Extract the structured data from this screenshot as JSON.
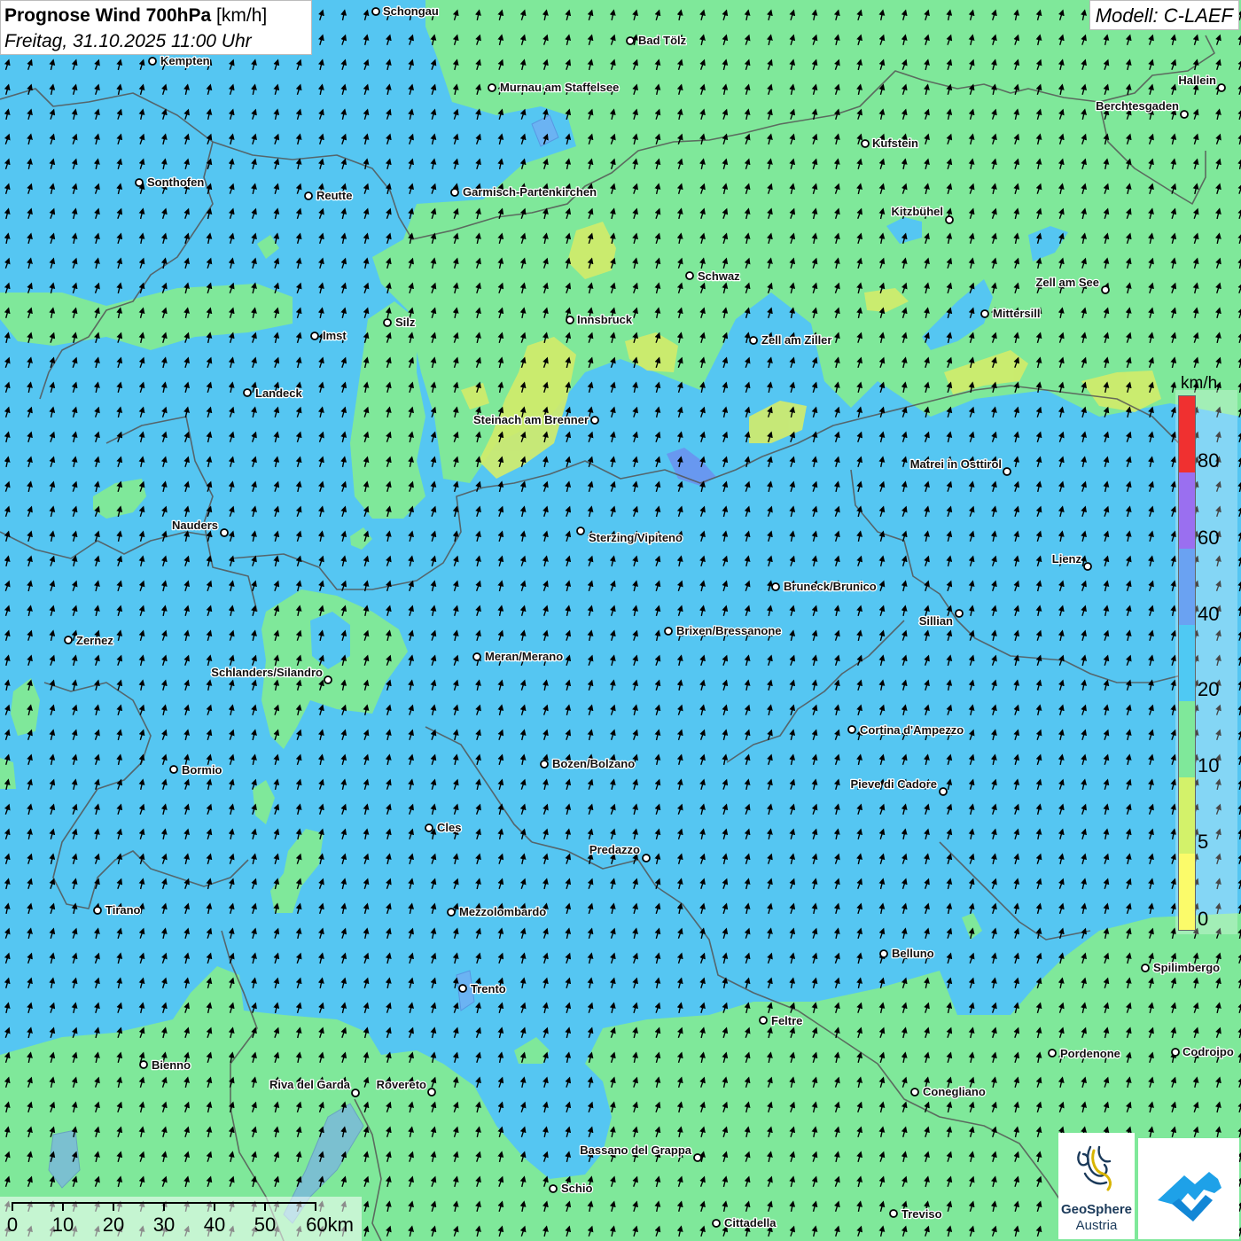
{
  "header": {
    "title_bold": "Prognose Wind 700hPa",
    "title_unit": "[km/h]",
    "subtitle": "Freitag, 31.10.2025 11:00 Uhr",
    "model": "Modell: C-LAEF"
  },
  "legend": {
    "unit": "km/h",
    "labels": [
      "80",
      "60",
      "40",
      "20",
      "10",
      "5",
      "0"
    ],
    "colors_top_to_bottom": [
      "#f03030",
      "#9a6ff0",
      "#6aa2f2",
      "#4fc9f3",
      "#7fe89a",
      "#d3f26a",
      "#fbfb6a"
    ]
  },
  "scale_bar": {
    "labels": [
      "0",
      "10",
      "20",
      "30",
      "40",
      "50",
      "60km"
    ]
  },
  "logos": {
    "geosphere_line1": "GeoSphere",
    "geosphere_line2": "Austria",
    "geosphere_icon": "geosphere-swirl-icon",
    "app_icon": "wetter-app-icon"
  },
  "map": {
    "wind_direction": "north-northeast",
    "arrow_icon": "wind-arrow-icon",
    "cities": [
      {
        "name": "Schongau"
      },
      {
        "name": "Bad Tölz"
      },
      {
        "name": "Kempten"
      },
      {
        "name": "Murnau am Staffelsee"
      },
      {
        "name": "Hallein"
      },
      {
        "name": "Berchtesgaden"
      },
      {
        "name": "Kufstein"
      },
      {
        "name": "Sonthofen"
      },
      {
        "name": "Reutte"
      },
      {
        "name": "Garmisch-Partenkirchen"
      },
      {
        "name": "Kitzbühel"
      },
      {
        "name": "Schwaz"
      },
      {
        "name": "Zell am See"
      },
      {
        "name": "Mittersill"
      },
      {
        "name": "Silz"
      },
      {
        "name": "Innsbruck"
      },
      {
        "name": "Imst"
      },
      {
        "name": "Zell am Ziller"
      },
      {
        "name": "Landeck"
      },
      {
        "name": "Steinach am Brenner"
      },
      {
        "name": "Matrei in Osttirol"
      },
      {
        "name": "Nauders"
      },
      {
        "name": "Sterzing/Vipiteno"
      },
      {
        "name": "Lienz"
      },
      {
        "name": "Bruneck/Brunico"
      },
      {
        "name": "Sillian"
      },
      {
        "name": "Zernez"
      },
      {
        "name": "Brixen/Bressanone"
      },
      {
        "name": "Meran/Merano"
      },
      {
        "name": "Schlanders/Silandro"
      },
      {
        "name": "Cortina d'Ampezzo"
      },
      {
        "name": "Bormio"
      },
      {
        "name": "Bozen/Bolzano"
      },
      {
        "name": "Pieve di Cadore"
      },
      {
        "name": "Cles"
      },
      {
        "name": "Predazzo"
      },
      {
        "name": "Tirano"
      },
      {
        "name": "Mezzolombardo"
      },
      {
        "name": "Belluno"
      },
      {
        "name": "Spilimbergo"
      },
      {
        "name": "Trento"
      },
      {
        "name": "Feltre"
      },
      {
        "name": "Pordenone"
      },
      {
        "name": "Codroipo"
      },
      {
        "name": "Bienno"
      },
      {
        "name": "Riva del Garda"
      },
      {
        "name": "Rovereto"
      },
      {
        "name": "Conegliano"
      },
      {
        "name": "Bassano del Grappa"
      },
      {
        "name": "Schio"
      },
      {
        "name": "Treviso"
      },
      {
        "name": "Cittadella"
      }
    ]
  }
}
